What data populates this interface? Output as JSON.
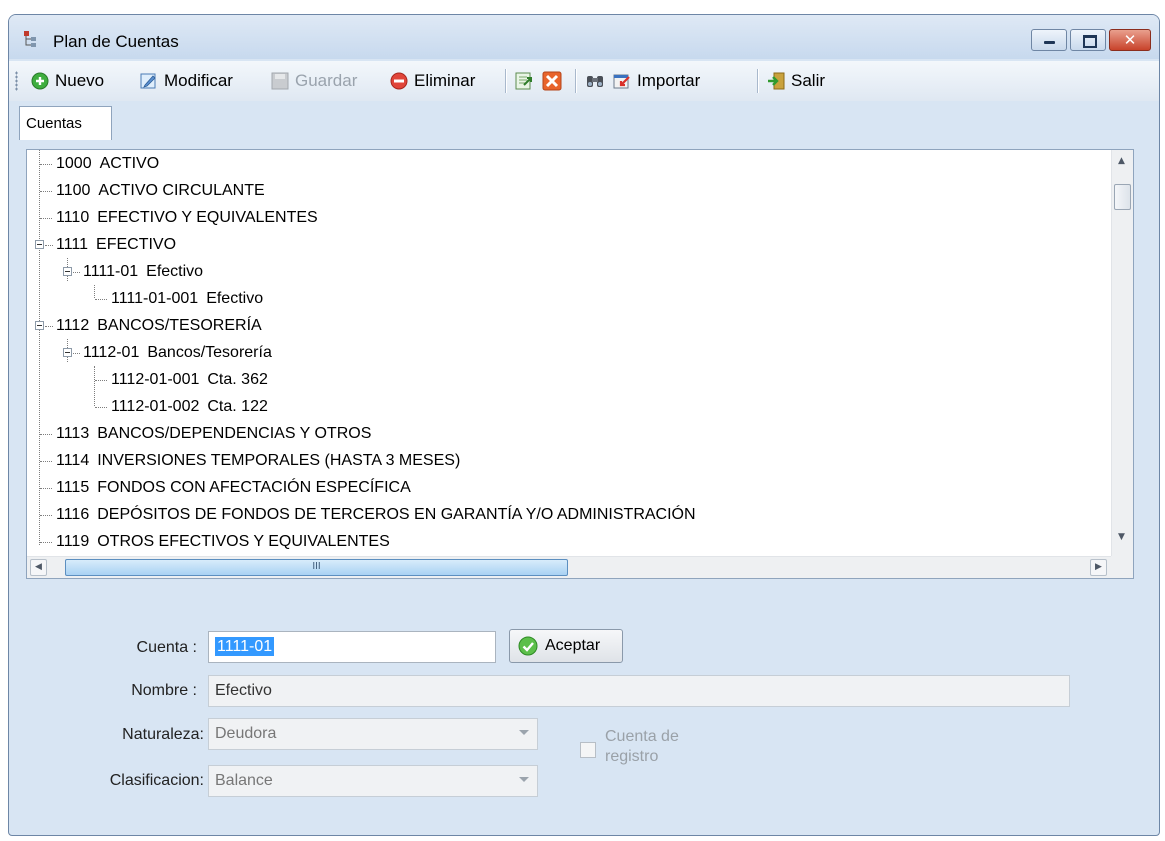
{
  "window": {
    "title": "Plan de Cuentas",
    "controls": {
      "minimize": "minimize-icon",
      "maximize": "maximize-icon",
      "close": "✕"
    }
  },
  "toolbar": {
    "nuevo": "Nuevo",
    "modificar": "Modificar",
    "guardar": "Guardar",
    "eliminar": "Eliminar",
    "importar": "Importar",
    "salir": "Salir"
  },
  "tabs": [
    {
      "label": "Cuentas",
      "active": true
    }
  ],
  "tree": [
    {
      "code": "1000",
      "name": "ACTIVO"
    },
    {
      "code": "1100",
      "name": "ACTIVO CIRCULANTE"
    },
    {
      "code": "1110",
      "name": "EFECTIVO Y EQUIVALENTES"
    },
    {
      "code": "1111",
      "name": "EFECTIVO",
      "expanded": true
    },
    {
      "code": "1111-01",
      "name": "Efectivo",
      "expanded": true
    },
    {
      "code": "1111-01-001",
      "name": "Efectivo"
    },
    {
      "code": "1112",
      "name": "BANCOS/TESORERÍA",
      "expanded": true
    },
    {
      "code": "1112-01",
      "name": "Bancos/Tesorería",
      "expanded": true
    },
    {
      "code": "1112-01-001",
      "name": "Cta. 362"
    },
    {
      "code": "1112-01-002",
      "name": "Cta. 122"
    },
    {
      "code": "1113",
      "name": "BANCOS/DEPENDENCIAS Y OTROS"
    },
    {
      "code": "1114",
      "name": "INVERSIONES TEMPORALES (HASTA 3 MESES)"
    },
    {
      "code": "1115",
      "name": "FONDOS CON AFECTACIÓN ESPECÍFICA"
    },
    {
      "code": "1116",
      "name": "DEPÓSITOS DE FONDOS DE TERCEROS EN GARANTÍA Y/O ADMINISTRACIÓN"
    },
    {
      "code": "1119",
      "name": "OTROS EFECTIVOS Y EQUIVALENTES"
    }
  ],
  "scroll": {
    "hthumb_grip": "III"
  },
  "form": {
    "cuenta_label": "Cuenta :",
    "cuenta_value": "1111-01",
    "aceptar_label": "Aceptar",
    "nombre_label": "Nombre :",
    "nombre_value": "Efectivo",
    "naturaleza_label": "Naturaleza:",
    "naturaleza_value": "Deudora",
    "clasificacion_label": "Clasificacion:",
    "clasificacion_value": "Balance",
    "cuenta_registro_line1": "Cuenta de",
    "cuenta_registro_line2": "registro",
    "cuenta_registro_checked": false
  }
}
